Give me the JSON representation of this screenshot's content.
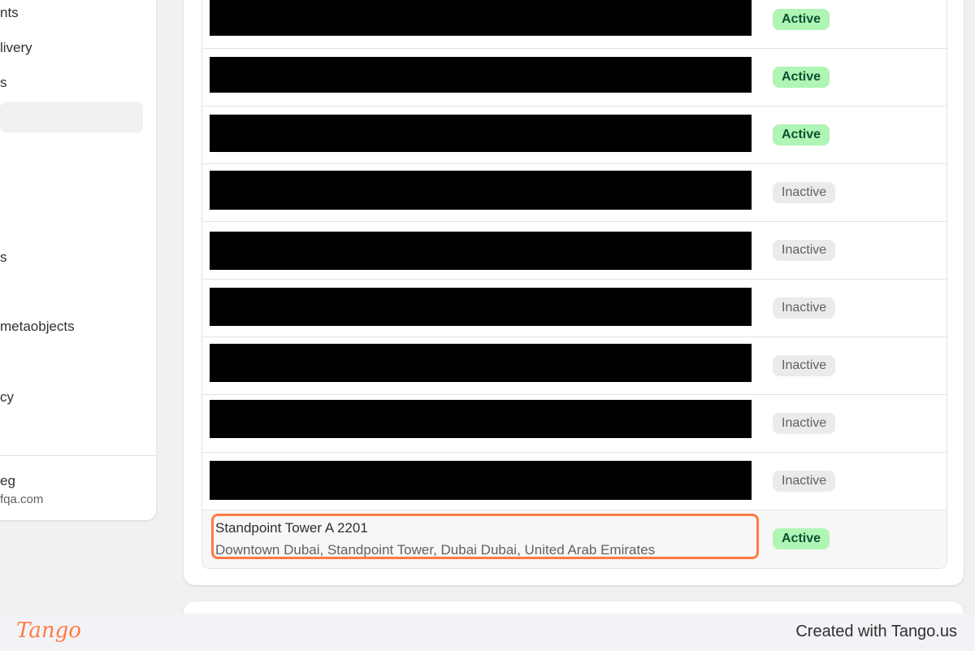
{
  "sidebar": {
    "items": [
      "nts",
      "livery",
      "s",
      "s",
      "metaobjects",
      "cy"
    ],
    "user_name": "eg",
    "user_email": "fqa.com"
  },
  "table": {
    "rows": [
      {
        "status": "Active"
      },
      {
        "status": "Active"
      },
      {
        "status": "Active"
      },
      {
        "status": "Inactive"
      },
      {
        "status": "Inactive"
      },
      {
        "status": "Inactive"
      },
      {
        "status": "Inactive"
      },
      {
        "status": "Inactive"
      },
      {
        "status": "Inactive"
      },
      {
        "title": "Standpoint Tower A 2201",
        "address": "Downtown Dubai, Standpoint Tower, Dubai Dubai, United Arab Emirates",
        "status": "Active"
      }
    ]
  },
  "footer": {
    "logo_text": "Tango",
    "credit": "Created with Tango.us"
  },
  "colors": {
    "active_badge_bg": "#aff5b4",
    "active_badge_text": "#0c5132",
    "inactive_badge_bg": "#ebebeb",
    "highlight": "#ff7a45"
  }
}
